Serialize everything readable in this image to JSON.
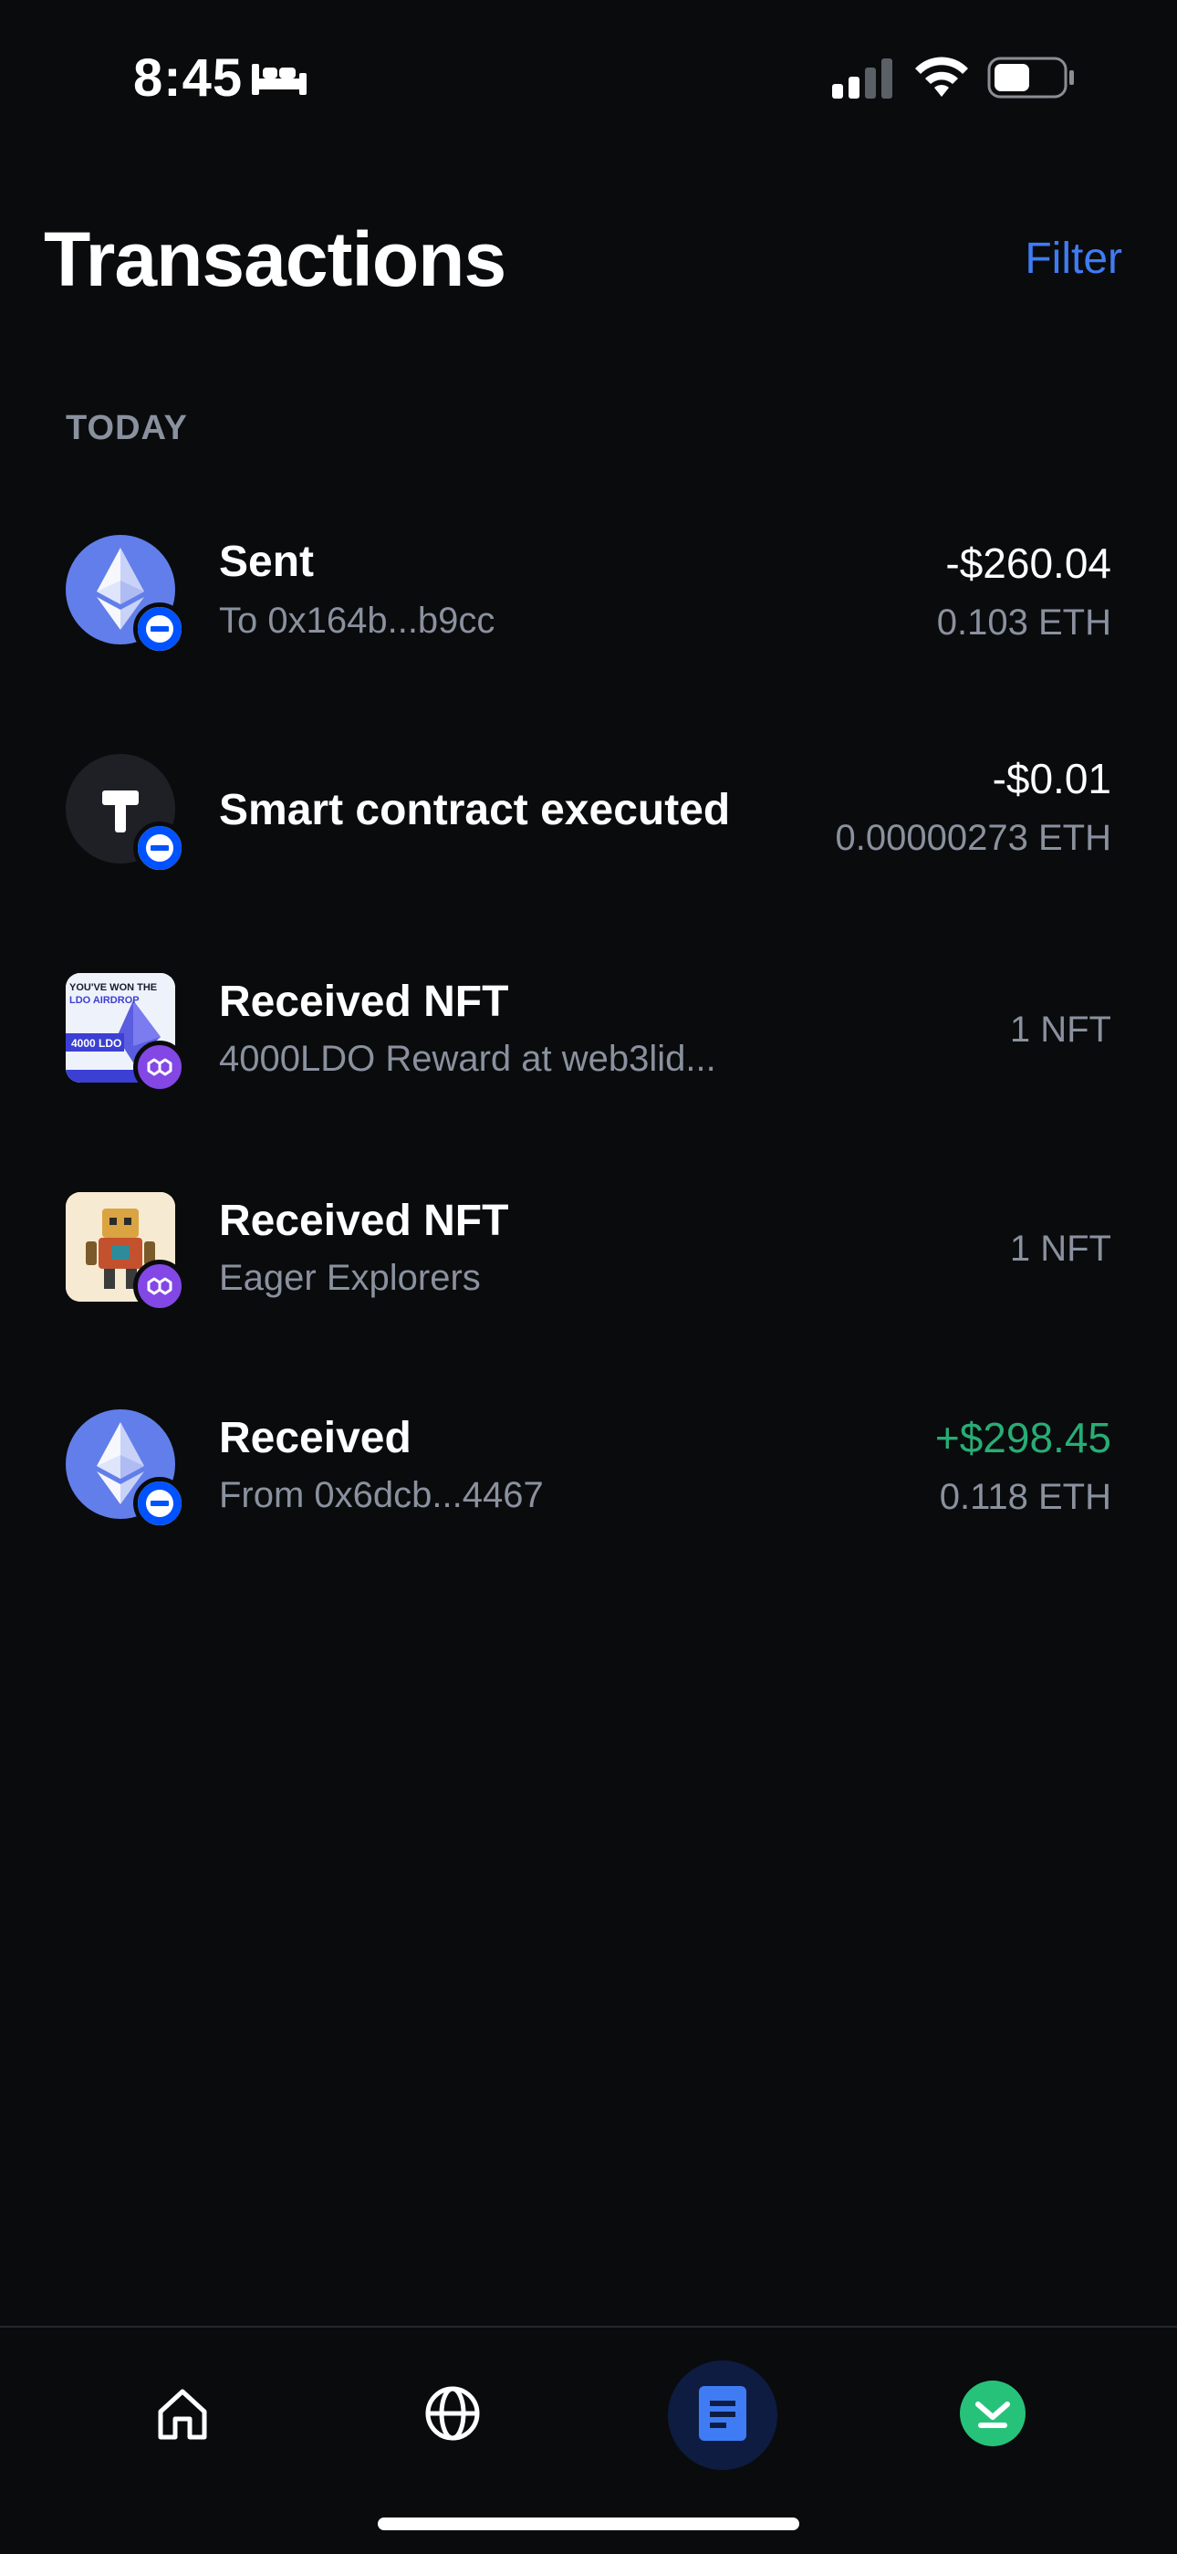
{
  "status_bar": {
    "time": "8:45"
  },
  "header": {
    "title": "Transactions",
    "filter_label": "Filter"
  },
  "section": {
    "label": "TODAY"
  },
  "transactions": [
    {
      "title": "Sent",
      "subtitle": "To 0x164b...b9cc",
      "fiat": "-$260.04",
      "crypto": "0.103 ETH",
      "icon": "ethereum-icon",
      "badge": "ethereum-network-badge"
    },
    {
      "title": "Smart contract executed",
      "subtitle": "",
      "fiat": "-$0.01",
      "crypto": "0.00000273 ETH",
      "icon": "hammer-icon",
      "badge": "ethereum-network-badge"
    },
    {
      "title": "Received NFT",
      "subtitle": "4000LDO Reward at web3lid...",
      "amount": "1 NFT",
      "icon": "nft-thumbnail",
      "badge": "polygon-network-badge",
      "thumbnail_text": {
        "line1": "YOU'VE WON THE",
        "line2": "LDO AIRDROP",
        "line3": "4000 LDO"
      }
    },
    {
      "title": "Received NFT",
      "subtitle": "Eager Explorers",
      "amount": "1 NFT",
      "icon": "nft-thumbnail",
      "badge": "polygon-network-badge"
    },
    {
      "title": "Received",
      "subtitle": "From 0x6dcb...4467",
      "fiat": "+$298.45",
      "crypto": "0.118 ETH",
      "icon": "ethereum-icon",
      "badge": "ethereum-network-badge"
    }
  ],
  "tab_bar": {
    "tabs": [
      {
        "name": "home",
        "icon": "home-icon"
      },
      {
        "name": "browser",
        "icon": "globe-icon"
      },
      {
        "name": "transactions",
        "icon": "document-icon",
        "active": true
      },
      {
        "name": "receive",
        "icon": "download-icon"
      }
    ]
  },
  "colors": {
    "background": "#0a0b0d",
    "accent": "#3f7cf4",
    "positive": "#27ad75",
    "muted": "#8a919e",
    "ethereum": "#627eea",
    "polygon": "#8247e5"
  }
}
